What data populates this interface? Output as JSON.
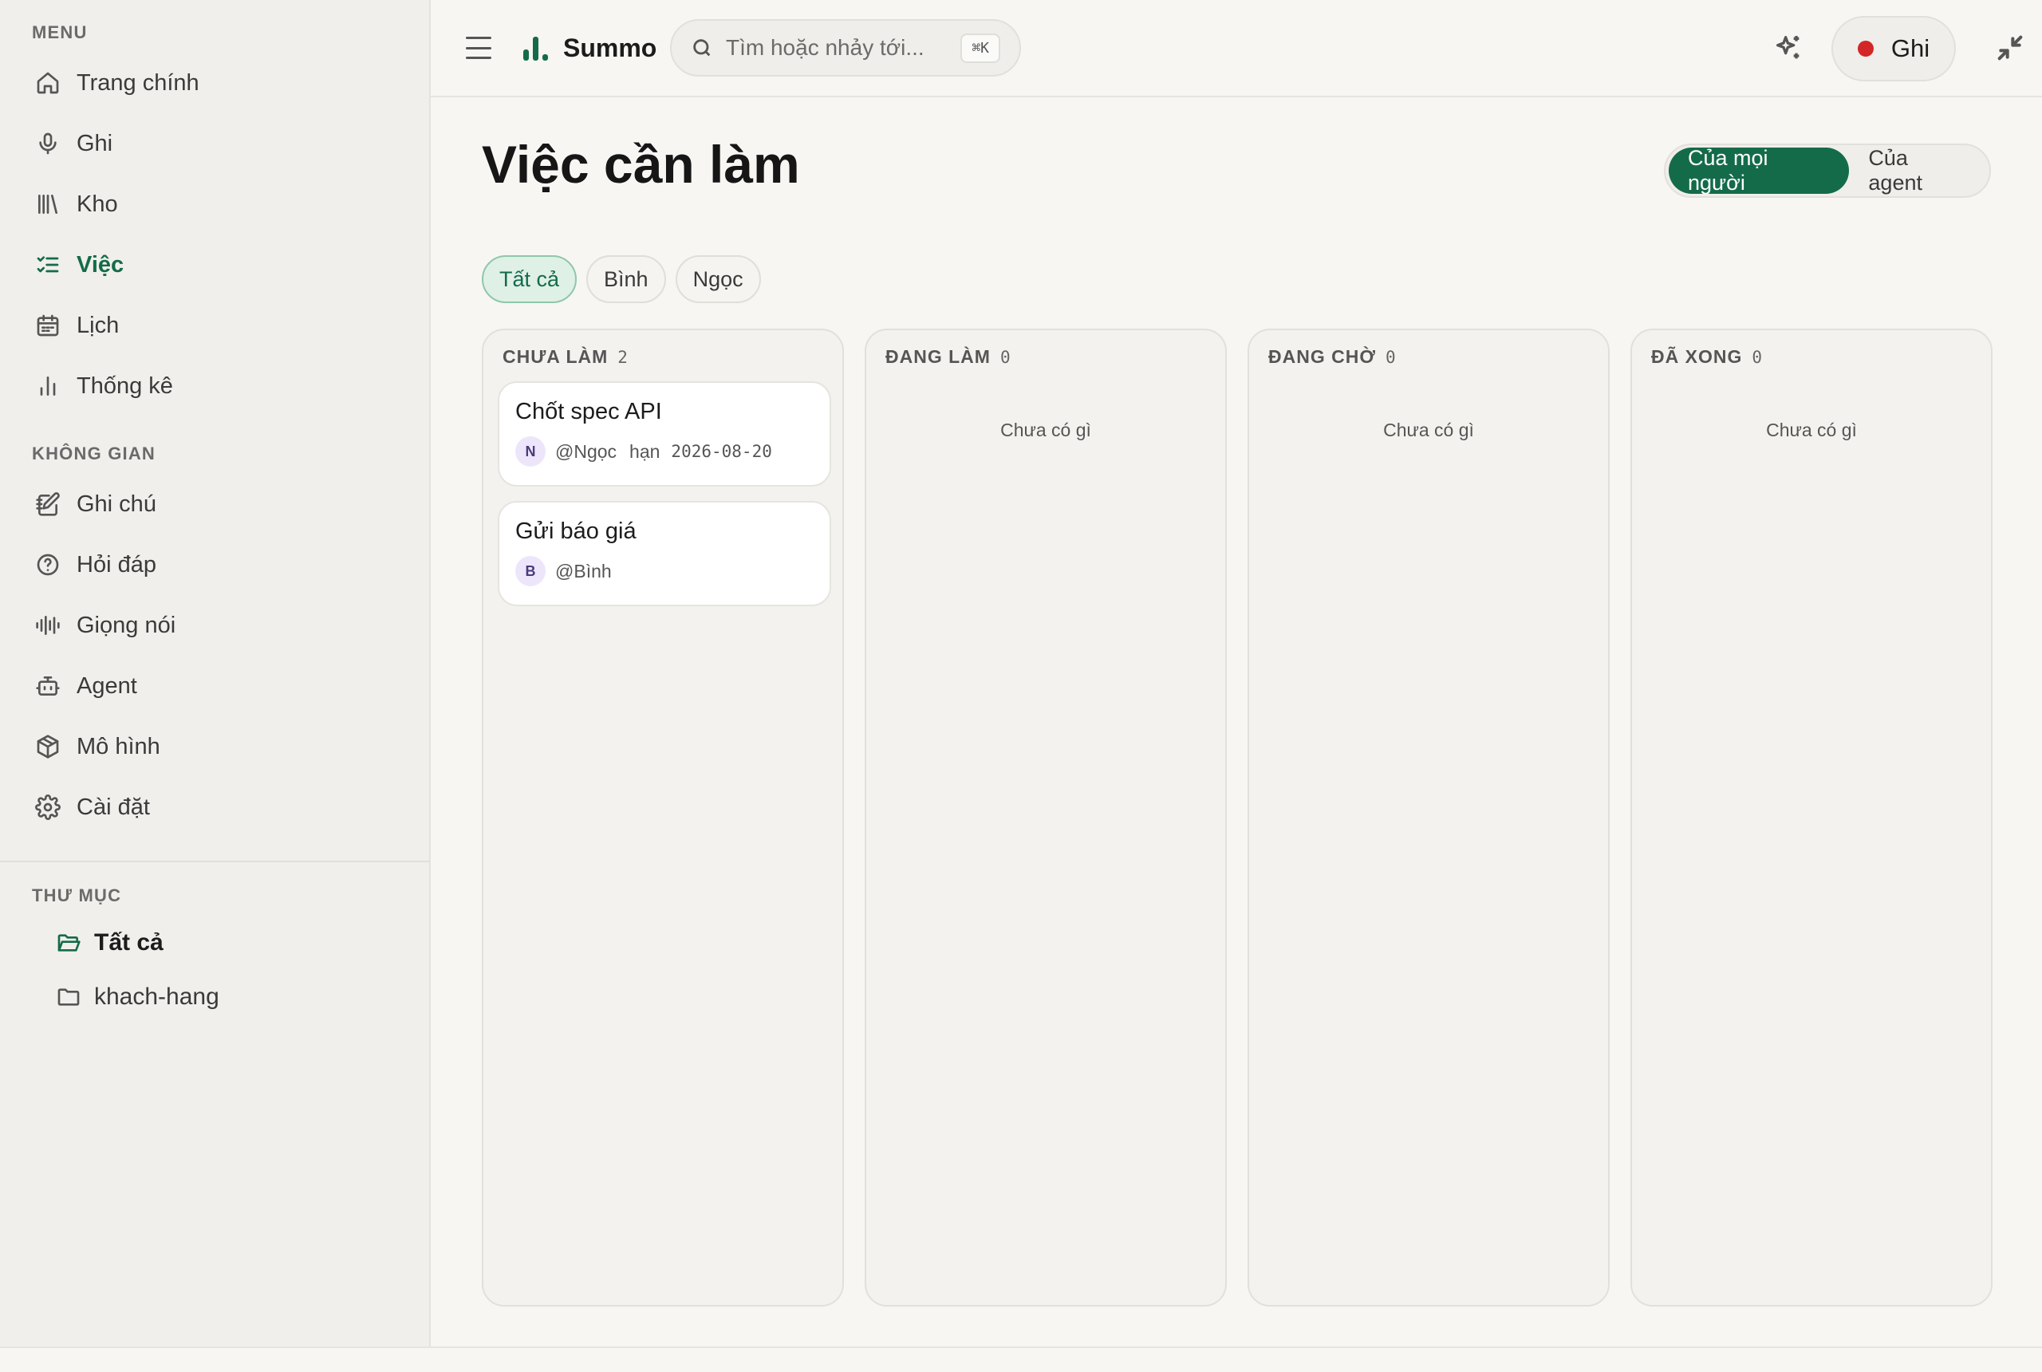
{
  "sidebar": {
    "menu_label": "MENU",
    "menu_items": [
      {
        "label": "Trang chính",
        "icon": "home-icon"
      },
      {
        "label": "Ghi",
        "icon": "microphone-icon"
      },
      {
        "label": "Kho",
        "icon": "library-icon"
      },
      {
        "label": "Việc",
        "icon": "checklist-icon",
        "active": true
      },
      {
        "label": "Lịch",
        "icon": "calendar-icon"
      },
      {
        "label": "Thống kê",
        "icon": "bar-chart-icon"
      }
    ],
    "space_label": "KHÔNG GIAN",
    "space_items": [
      {
        "label": "Ghi chú",
        "icon": "notebook-pen-icon"
      },
      {
        "label": "Hỏi đáp",
        "icon": "help-circle-icon"
      },
      {
        "label": "Giọng nói",
        "icon": "audio-lines-icon"
      },
      {
        "label": "Agent",
        "icon": "bot-icon"
      },
      {
        "label": "Mô hình",
        "icon": "package-icon"
      },
      {
        "label": "Cài đặt",
        "icon": "gear-icon"
      }
    ],
    "folders_label": "THƯ MỤC",
    "folders": [
      {
        "label": "Tất cả",
        "icon": "folder-open-icon",
        "active": true
      },
      {
        "label": "khach-hang",
        "icon": "folder-icon"
      }
    ]
  },
  "topbar": {
    "brand": "Summo",
    "search_placeholder": "Tìm hoặc nhảy tới...",
    "search_shortcut": "⌘K",
    "record_label": "Ghi"
  },
  "page": {
    "title": "Việc cần làm",
    "scope": [
      "Của mọi người",
      "Của agent"
    ],
    "scope_active": "Của mọi người",
    "filters": [
      "Tất cả",
      "Bình",
      "Ngọc"
    ],
    "filter_active": "Tất cả"
  },
  "board": {
    "columns": [
      {
        "title": "CHƯA LÀM",
        "count": "2",
        "cards": [
          {
            "title": "Chốt spec API",
            "avatar": "N",
            "assignee": "@Ngọc",
            "due_label": "hạn",
            "due_date": "2026-08-20"
          },
          {
            "title": "Gửi báo giá",
            "avatar": "B",
            "assignee": "@Bình"
          }
        ]
      },
      {
        "title": "ĐANG LÀM",
        "count": "0",
        "empty_text": "Chưa có gì"
      },
      {
        "title": "ĐANG CHỜ",
        "count": "0",
        "empty_text": "Chưa có gì"
      },
      {
        "title": "ĐÃ XONG",
        "count": "0",
        "empty_text": "Chưa có gì"
      }
    ]
  },
  "colors": {
    "accent": "#146b4a",
    "record_dot": "#d32626",
    "avatar_bg": "#ede6fb"
  }
}
